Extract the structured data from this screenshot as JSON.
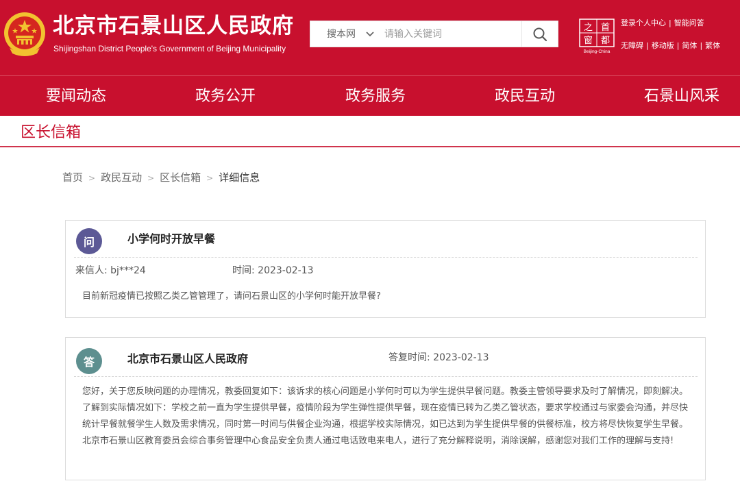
{
  "header": {
    "title_cn": "北京市石景山区人民政府",
    "title_en": "Shijingshan District People's Government of Beijing Municipality",
    "search": {
      "scope": "搜本网",
      "placeholder": "请输入关键词"
    },
    "capital_logo": {
      "chars": [
        "之",
        "首",
        "窗",
        "都"
      ],
      "caption": "Beijing-China"
    },
    "links_row1": [
      "登录个人中心",
      "智能问答"
    ],
    "links_row2": [
      "无障碍",
      "移动版",
      "简体",
      "繁体"
    ],
    "separator": "|"
  },
  "nav": {
    "items": [
      "要闻动态",
      "政务公开",
      "政务服务",
      "政民互动",
      "石景山风采"
    ]
  },
  "section": {
    "title": "区长信箱"
  },
  "breadcrumb": {
    "items": [
      "首页",
      "政民互动",
      "区长信箱",
      "详细信息"
    ],
    "separator": ">"
  },
  "question": {
    "badge": "问",
    "title": "小学何时开放早餐",
    "sender_label": "来信人:",
    "sender": "bj***24",
    "time_label": "时间:",
    "time": "2023-02-13",
    "content": "目前新冠疫情已按照乙类乙管管理了，请问石景山区的小学何时能开放早餐?"
  },
  "answer": {
    "badge": "答",
    "org": "北京市石景山区人民政府",
    "time_label": "答复时间:",
    "time": "2023-02-13",
    "content": "您好，关于您反映问题的办理情况，教委回复如下：该诉求的核心问题是小学何时可以为学生提供早餐问题。教委主管领导要求及时了解情况，即刻解决。 了解到实际情况如下：学校之前一直为学生提供早餐，疫情阶段为学生弹性提供早餐，现在疫情已转为乙类乙管状态，要求学校通过与家委会沟通，并尽快统计早餐就餐学生人数及需求情况，同时第一时间与供餐企业沟通，根据学校实际情况，如已达到为学生提供早餐的供餐标准，校方将尽快恢复学生早餐。 北京市石景山区教育委员会综合事务管理中心食品安全负责人通过电话致电来电人，进行了充分解释说明，消除误解，感谢您对我们工作的理解与支持!"
  },
  "colors": {
    "brand_red": "#c8102e",
    "ask_badge": "#5c5996",
    "answer_badge": "#5d8f8f"
  },
  "icons": [
    "national-emblem-icon",
    "chevron-down-icon",
    "search-icon",
    "capital-window-logo"
  ]
}
